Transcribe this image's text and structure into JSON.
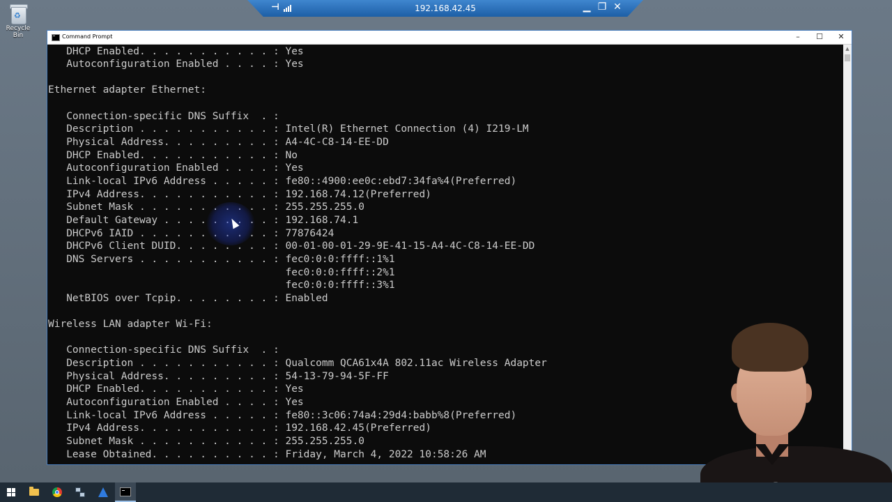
{
  "desktop": {
    "recycle_bin_label": "Recycle Bin"
  },
  "rdp_bar": {
    "host": "192.168.42.45",
    "icons": [
      "pin-icon",
      "signal-icon",
      "minimize-icon",
      "restore-icon",
      "close-icon"
    ]
  },
  "window": {
    "title": "Command Prompt",
    "controls": [
      "minimize",
      "maximize",
      "close"
    ]
  },
  "console": {
    "lines": [
      "   DHCP Enabled. . . . . . . . . . . : Yes",
      "   Autoconfiguration Enabled . . . . : Yes",
      "",
      "Ethernet adapter Ethernet:",
      "",
      "   Connection-specific DNS Suffix  . :",
      "   Description . . . . . . . . . . . : Intel(R) Ethernet Connection (4) I219-LM",
      "   Physical Address. . . . . . . . . : A4-4C-C8-14-EE-DD",
      "   DHCP Enabled. . . . . . . . . . . : No",
      "   Autoconfiguration Enabled . . . . : Yes",
      "   Link-local IPv6 Address . . . . . : fe80::4900:ee0c:ebd7:34fa%4(Preferred)",
      "   IPv4 Address. . . . . . . . . . . : 192.168.74.12(Preferred)",
      "   Subnet Mask . . . . . . . . . . . : 255.255.255.0",
      "   Default Gateway . . . . . . . . . : 192.168.74.1",
      "   DHCPv6 IAID . . . . . . . . . . . : 77876424",
      "   DHCPv6 Client DUID. . . . . . . . : 00-01-00-01-29-9E-41-15-A4-4C-C8-14-EE-DD",
      "   DNS Servers . . . . . . . . . . . : fec0:0:0:ffff::1%1",
      "                                       fec0:0:0:ffff::2%1",
      "                                       fec0:0:0:ffff::3%1",
      "   NetBIOS over Tcpip. . . . . . . . : Enabled",
      "",
      "Wireless LAN adapter Wi-Fi:",
      "",
      "   Connection-specific DNS Suffix  . :",
      "   Description . . . . . . . . . . . : Qualcomm QCA61x4A 802.11ac Wireless Adapter",
      "   Physical Address. . . . . . . . . : 54-13-79-94-5F-FF",
      "   DHCP Enabled. . . . . . . . . . . : Yes",
      "   Autoconfiguration Enabled . . . . : Yes",
      "   Link-local IPv6 Address . . . . . : fe80::3c06:74a4:29d4:babb%8(Preferred)",
      "   IPv4 Address. . . . . . . . . . . : 192.168.42.45(Preferred)",
      "   Subnet Mask . . . . . . . . . . . : 255.255.255.0",
      "   Lease Obtained. . . . . . . . . . : Friday, March 4, 2022 10:58:26 AM"
    ],
    "text_color": "#cccccc",
    "background_color": "#0c0c0c"
  },
  "taskbar": {
    "items": [
      "start-icon",
      "file-explorer-icon",
      "chrome-icon",
      "network-icon",
      "sail-app-icon",
      "command-prompt-icon"
    ],
    "active_item": "command-prompt-icon"
  }
}
